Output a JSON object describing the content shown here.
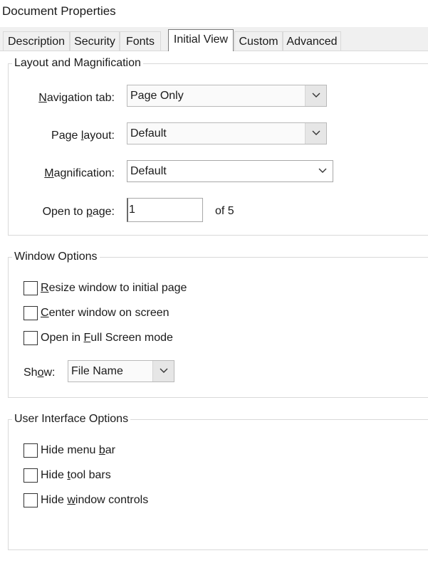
{
  "window": {
    "title": "Document Properties"
  },
  "tabs": [
    {
      "label": "Description",
      "active": false
    },
    {
      "label": "Security",
      "active": false
    },
    {
      "label": "Fonts",
      "active": false
    },
    {
      "label": "Initial View",
      "active": true
    },
    {
      "label": "Custom",
      "active": false
    },
    {
      "label": "Advanced",
      "active": false
    }
  ],
  "layout_group": {
    "legend": "Layout and Magnification",
    "navigation_tab": {
      "label_pre": "",
      "label_u": "N",
      "label_post": "avigation tab:",
      "value": "Page Only"
    },
    "page_layout": {
      "label_pre": "Page ",
      "label_u": "l",
      "label_post": "ayout:",
      "value": "Default"
    },
    "magnification": {
      "label_pre": "",
      "label_u": "M",
      "label_post": "agnification:",
      "value": "Default"
    },
    "open_to_page": {
      "label_pre": "Open to ",
      "label_u": "p",
      "label_post": "age:",
      "value": "1",
      "of_text": "of 5"
    }
  },
  "window_group": {
    "legend": "Window Options",
    "options": [
      {
        "pre": "",
        "u": "R",
        "post": "esize window to initial page",
        "checked": false
      },
      {
        "pre": "",
        "u": "C",
        "post": "enter window on screen",
        "checked": false
      },
      {
        "pre": "Open in ",
        "u": "F",
        "post": "ull Screen mode",
        "checked": false
      }
    ],
    "show": {
      "label_pre": "Sh",
      "label_u": "o",
      "label_post": "w:",
      "value": "File Name"
    }
  },
  "ui_group": {
    "legend": "User Interface Options",
    "options": [
      {
        "pre": "Hide menu ",
        "u": "b",
        "post": "ar",
        "checked": false
      },
      {
        "pre": "Hide ",
        "u": "t",
        "post": "ool bars",
        "checked": false
      },
      {
        "pre": "Hide ",
        "u": "w",
        "post": "indow controls",
        "checked": false
      }
    ]
  },
  "colors": {
    "background": "#ffffff",
    "tabstrip": "#f0f0f0",
    "border": "#d9d9d9",
    "text": "#1a1a1a"
  }
}
